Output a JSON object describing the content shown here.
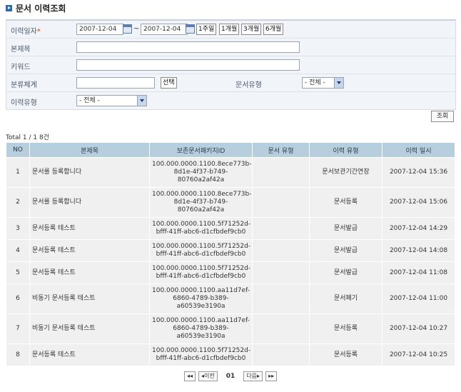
{
  "header": {
    "title": "문서 이력조회"
  },
  "search": {
    "date_label": "이력일자",
    "required_mark": "*",
    "date_from": "2007-12-04",
    "date_to": "2007-12-04",
    "tilde": "~",
    "quick_buttons": [
      "1주일",
      "1개월",
      "3개월",
      "6개월"
    ],
    "title_label": "본제목",
    "title_value": "",
    "keyword_label": "키워드",
    "keyword_value": "",
    "class_label": "분류체계",
    "class_value": "",
    "select_button": "선택",
    "doc_type_label": "문서유형",
    "doc_type_value": "- 전체 -",
    "history_type_label": "이력유형",
    "history_type_value": "- 전체 -",
    "query_button": "조회"
  },
  "list": {
    "total_text": "Total 1 / 1  8건",
    "columns": [
      "NO",
      "본제목",
      "보존문서패키지ID",
      "문서 유형",
      "이력 유형",
      "이력 일시"
    ],
    "rows": [
      {
        "no": "1",
        "title": "문서를 등록합니다",
        "pkg_id": "100.000.0000.1100.8ece773b-8d1e-4f37-b749-80760a2af42a",
        "doc_type": "",
        "history_type": "문서보관기간연장",
        "datetime": "2007-12-04 15:36"
      },
      {
        "no": "2",
        "title": "문서를 등록합니다",
        "pkg_id": "100.000.0000.1100.8ece773b-8d1e-4f37-b749-80760a2af42a",
        "doc_type": "",
        "history_type": "문서등록",
        "datetime": "2007-12-04 15:06"
      },
      {
        "no": "3",
        "title": "문서등록 테스트",
        "pkg_id": "100.000.0000.1100.5f71252d-bfff-41ff-abc6-d1cfbdef9cb0",
        "doc_type": "",
        "history_type": "문서발급",
        "datetime": "2007-12-04 14:29"
      },
      {
        "no": "4",
        "title": "문서등록 테스트",
        "pkg_id": "100.000.0000.1100.5f71252d-bfff-41ff-abc6-d1cfbdef9cb0",
        "doc_type": "",
        "history_type": "문서발급",
        "datetime": "2007-12-04 14:08"
      },
      {
        "no": "5",
        "title": "문서등록 테스트",
        "pkg_id": "100.000.0000.1100.5f71252d-bfff-41ff-abc6-d1cfbdef9cb0",
        "doc_type": "",
        "history_type": "문서발급",
        "datetime": "2007-12-04 11:08"
      },
      {
        "no": "6",
        "title": "비동기 문서등록 테스트",
        "pkg_id": "100.000.0000.1100.aa11d7ef-6860-4789-b389-a60539e3190a",
        "doc_type": "",
        "history_type": "문서폐기",
        "datetime": "2007-12-04 11:00"
      },
      {
        "no": "7",
        "title": "비동기 문서등록 테스트",
        "pkg_id": "100.000.0000.1100.aa11d7ef-6860-4789-b389-a60539e3190a",
        "doc_type": "",
        "history_type": "문서등록",
        "datetime": "2007-12-04 10:27"
      },
      {
        "no": "8",
        "title": "문서등록 테스트",
        "pkg_id": "100.000.0000.1100.5f71252d-bfff-41ff-abc6-d1cfbdef9cb0",
        "doc_type": "",
        "history_type": "문서등록",
        "datetime": "2007-12-04 10:25"
      }
    ]
  },
  "pager": {
    "first": "◂◂",
    "prev": "◂이전",
    "current": "01",
    "next": "다음▸",
    "last": "▸▸"
  }
}
